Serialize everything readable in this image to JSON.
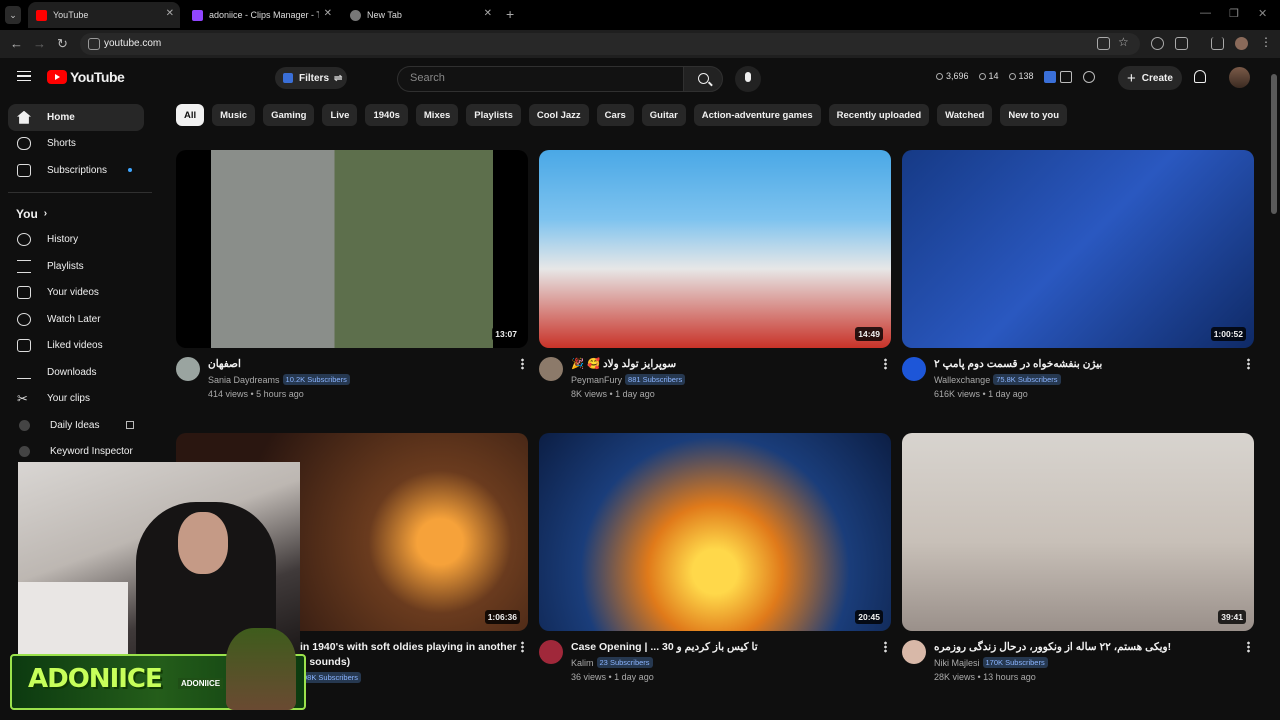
{
  "browser": {
    "tabs": [
      {
        "title": "YouTube",
        "active": true
      },
      {
        "title": "adoniice - Clips Manager - Twit",
        "active": false
      },
      {
        "title": "New Tab",
        "active": false
      }
    ],
    "url": "youtube.com"
  },
  "header": {
    "logo_text": "YouTube",
    "filters_label": "Filters",
    "search_placeholder": "Search",
    "stats": {
      "views": "3,696",
      "watch": "14",
      "subs": "138"
    },
    "create_label": "Create"
  },
  "sidebar": {
    "main": [
      {
        "label": "Home",
        "icon": "home-icon",
        "active": true
      },
      {
        "label": "Shorts",
        "icon": "shorts-icon"
      },
      {
        "label": "Subscriptions",
        "icon": "subscriptions-icon"
      }
    ],
    "you_label": "You",
    "you_items": [
      {
        "label": "History",
        "icon": "history-icon"
      },
      {
        "label": "Playlists",
        "icon": "playlists-icon"
      },
      {
        "label": "Your videos",
        "icon": "your-videos-icon"
      },
      {
        "label": "Watch Later",
        "icon": "clock-icon"
      },
      {
        "label": "Liked videos",
        "icon": "thumbs-up-icon"
      },
      {
        "label": "Downloads",
        "icon": "download-icon"
      },
      {
        "label": "Your clips",
        "icon": "scissors-icon"
      }
    ],
    "extension_items": [
      {
        "label": "Daily Ideas",
        "icon": "extension-icon"
      },
      {
        "label": "Keyword Inspector",
        "icon": "extension-icon"
      }
    ]
  },
  "chips": [
    "All",
    "Music",
    "Gaming",
    "Live",
    "1940s",
    "Mixes",
    "Playlists",
    "Cool Jazz",
    "Cars",
    "Guitar",
    "Action-adventure games",
    "Recently uploaded",
    "Watched",
    "New to you"
  ],
  "videos": [
    {
      "title": "اصفهان",
      "channel": "Sania Daydreams",
      "subs": "10.2K Subscribers",
      "meta": "414 views • 5 hours ago",
      "duration": "13:07",
      "thumb": "#6b7f5a"
    },
    {
      "title": "🎉 🥰 سوپرایز تولد ولاد",
      "channel": "PeymanFury",
      "subs": "881 Subscribers",
      "meta": "8K views • 1 day ago",
      "duration": "14:49",
      "thumb": "#3b9ad8"
    },
    {
      "title": "بیژن بنفشه‌خواه در قسمت دوم پامپ ۲",
      "channel": "Wallexchange",
      "subs": "75.8K Subscribers",
      "meta": "616K views • 1 day ago",
      "duration": "1:00:52",
      "thumb": "#1f3d8a"
    },
    {
      "title": "in 1940's with soft oldies playing in another",
      "title2": "n sounds)",
      "channel": "",
      "subs": "98K Subscribers",
      "meta": "",
      "duration": "1:06:36",
      "thumb": "#5a3320"
    },
    {
      "title": "Case Opening | ... 30 تا کیس باز کردیم و",
      "channel": "Kalim",
      "subs": "23 Subscribers",
      "meta": "36 views • 1 day ago",
      "duration": "20:45",
      "thumb": "#1a4c8c"
    },
    {
      "title": "ویکی هستم، ۲۲ ساله از ونکوور، درحال زندگی روزمره!",
      "channel": "Niki Majlesi",
      "subs": "170K Subscribers",
      "meta": "28K views • 13 hours ago",
      "duration": "39:41",
      "thumb": "#bfb8b2"
    }
  ],
  "stream_overlay": {
    "name": "ADONIICE",
    "tag": "ADONIICE"
  }
}
